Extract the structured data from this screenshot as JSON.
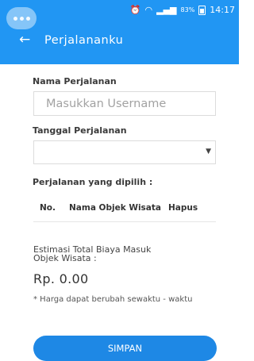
{
  "status_bar": {
    "battery_percent": "83%",
    "time": "14:17"
  },
  "toolbar": {
    "title": "Perjalananku"
  },
  "form": {
    "trip_name_label": "Nama Perjalanan",
    "trip_name_placeholder": "Masukkan Username",
    "trip_name_value": "",
    "trip_date_label": "Tanggal Perjalanan",
    "trip_date_value": "",
    "selected_label": "Perjalanan yang dipilih :"
  },
  "table": {
    "columns": [
      "No.",
      "Nama Objek Wisata",
      "Hapus"
    ],
    "rows": []
  },
  "estimate": {
    "label_line1": "Estimasi Total Biaya Masuk",
    "label_line2": "Objek Wisata :",
    "value": "Rp. 0.00",
    "note": "* Harga dapat berubah sewaktu - waktu"
  },
  "actions": {
    "save_label": "SIMPAN"
  },
  "colors": {
    "primary": "#2196f3",
    "button": "#1e88e5"
  }
}
